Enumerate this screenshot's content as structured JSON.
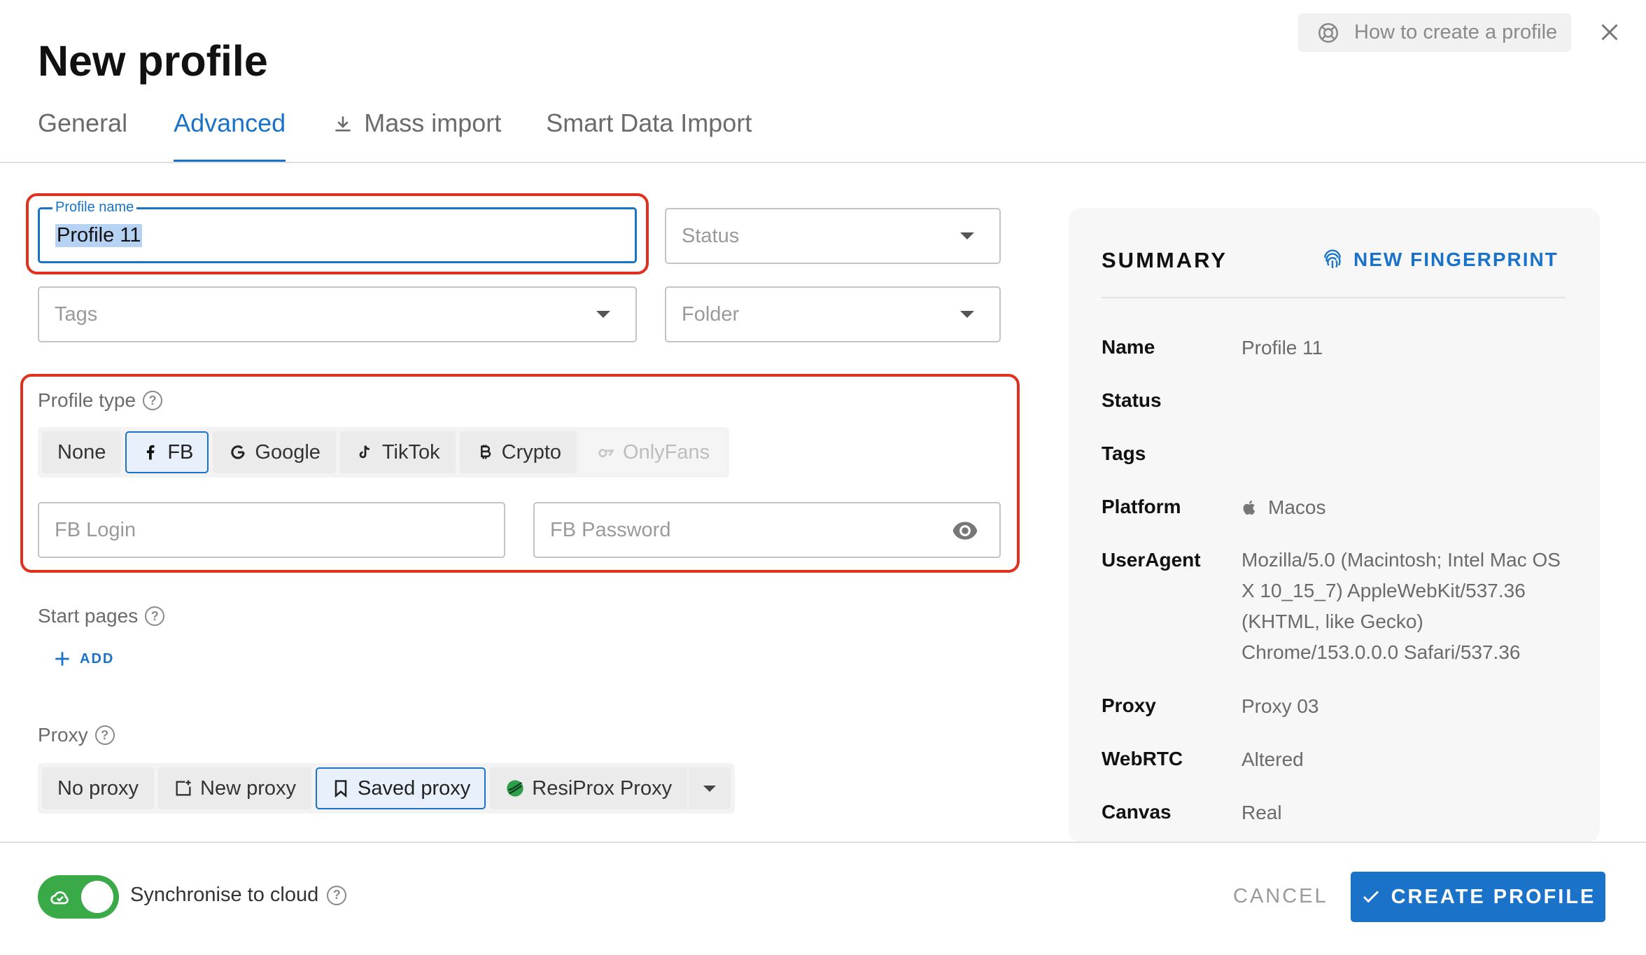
{
  "title": "New profile",
  "help_button": "How to create a profile",
  "tabs": [
    "General",
    "Advanced",
    "Mass import",
    "Smart Data Import"
  ],
  "fields": {
    "profile_name_label": "Profile name",
    "profile_name_value": "Profile 11",
    "status_placeholder": "Status",
    "tags_placeholder": "Tags",
    "folder_placeholder": "Folder",
    "fb_login_placeholder": "FB Login",
    "fb_password_placeholder": "FB Password"
  },
  "profile_type": {
    "label": "Profile type",
    "options": [
      "None",
      "FB",
      "Google",
      "TikTok",
      "Crypto",
      "OnlyFans"
    ],
    "selected": "FB"
  },
  "start_pages": {
    "label": "Start pages",
    "add": "ADD"
  },
  "proxy": {
    "label": "Proxy",
    "options": [
      "No proxy",
      "New proxy",
      "Saved proxy",
      "ResiProx Proxy"
    ],
    "selected": "Saved proxy"
  },
  "summary": {
    "heading": "SUMMARY",
    "new_fingerprint": "NEW FINGERPRINT",
    "rows": [
      {
        "key": "Name",
        "value": "Profile 11"
      },
      {
        "key": "Status",
        "value": ""
      },
      {
        "key": "Tags",
        "value": ""
      },
      {
        "key": "Platform",
        "value": "Macos"
      },
      {
        "key": "UserAgent",
        "value": "Mozilla/5.0 (Macintosh; Intel Mac OS X 10_15_7) AppleWebKit/537.36 (KHTML, like Gecko) Chrome/153.0.0.0 Safari/537.36"
      },
      {
        "key": "Proxy",
        "value": "Proxy 03"
      },
      {
        "key": "WebRTC",
        "value": "Altered"
      },
      {
        "key": "Canvas",
        "value": "Real"
      }
    ]
  },
  "footer": {
    "sync_label": "Synchronise to cloud",
    "sync_enabled": true,
    "cancel": "CANCEL",
    "create": "CREATE PROFILE"
  },
  "colors": {
    "accent": "#1a73c9",
    "highlight": "#e0301e",
    "toggle_on": "#3aa948"
  }
}
